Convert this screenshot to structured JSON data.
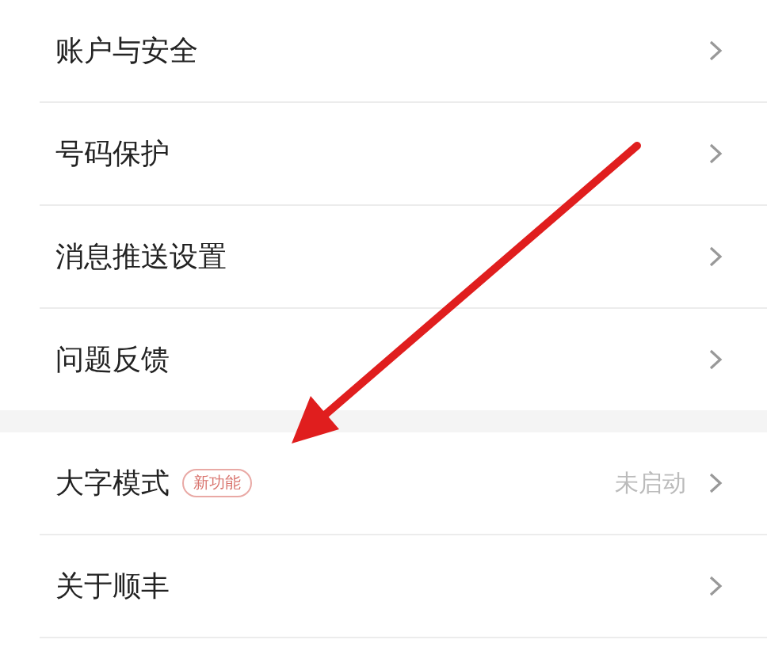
{
  "groups": [
    {
      "items": [
        {
          "label": "账户与安全"
        },
        {
          "label": "号码保护"
        },
        {
          "label": "消息推送设置"
        },
        {
          "label": "问题反馈"
        }
      ]
    },
    {
      "items": [
        {
          "label": "大字模式",
          "badge": "新功能",
          "value": "未启动"
        },
        {
          "label": "关于顺丰"
        }
      ]
    }
  ]
}
